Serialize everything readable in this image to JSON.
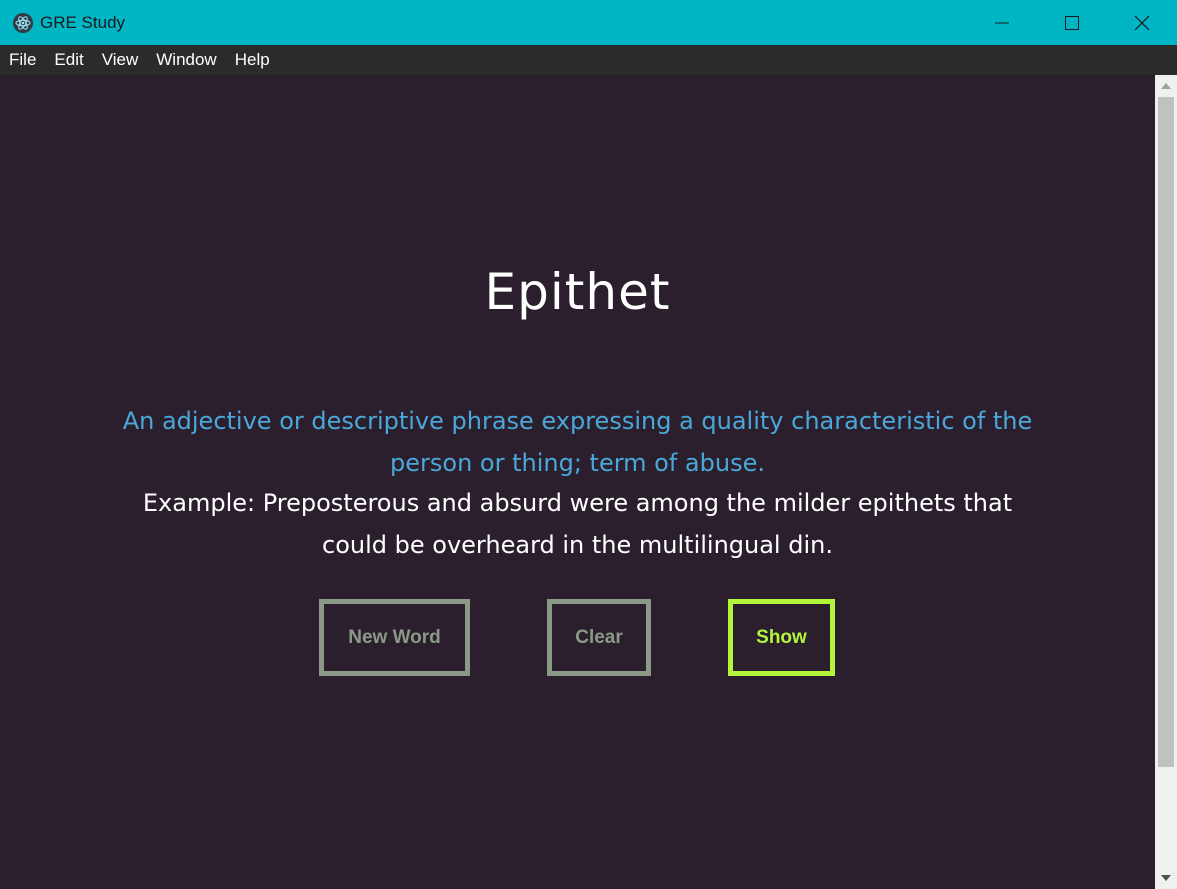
{
  "window": {
    "title": "GRE Study",
    "icon": "electron-atom-icon",
    "controls": [
      "minimize-icon",
      "maximize-icon",
      "close-icon"
    ]
  },
  "menu": {
    "items": [
      {
        "label": "File"
      },
      {
        "label": "Edit"
      },
      {
        "label": "View"
      },
      {
        "label": "Window"
      },
      {
        "label": "Help"
      }
    ]
  },
  "card": {
    "word": "Epithet",
    "definition": "An adjective or descriptive phrase expressing a quality characteristic of the person or thing; term of abuse.",
    "example": "Example: Preposterous and absurd were among the milder epithets that could be overheard in the multilingual din."
  },
  "buttons": {
    "new_word": "New Word",
    "clear": "Clear",
    "show": "Show"
  },
  "colors": {
    "titlebar": "#00b5c4",
    "background": "#2b1f2e",
    "definition": "#4aa8d8",
    "button_default": "#8a9a87",
    "button_accent": "#b2f53a"
  }
}
